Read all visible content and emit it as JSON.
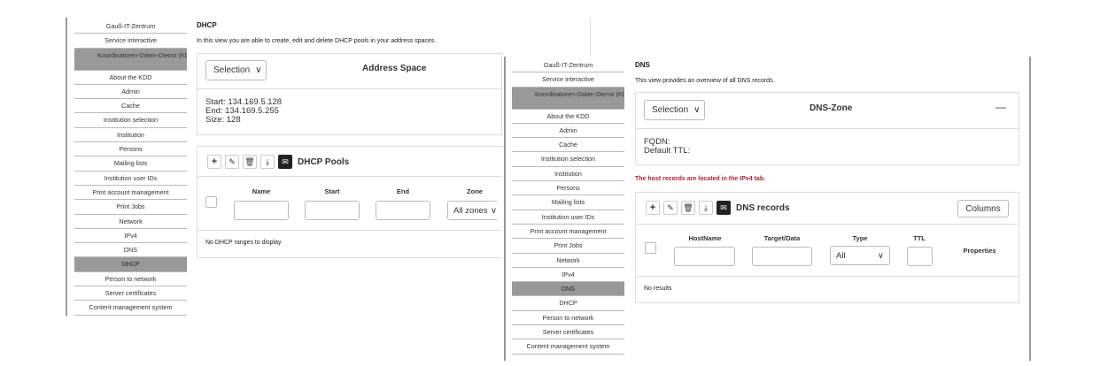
{
  "left": {
    "nav": [
      {
        "label": "Gauß-IT-Zentrum",
        "cls": "l0"
      },
      {
        "label": "Service interactive",
        "cls": "l0"
      },
      {
        "label": "Koordinatoren-Daten-Dienst (KDD)",
        "cls": "kdd"
      },
      {
        "label": "About the KDD",
        "cls": ""
      },
      {
        "label": "Admin",
        "cls": ""
      },
      {
        "label": "Cache",
        "cls": ""
      },
      {
        "label": "Institution selection",
        "cls": ""
      },
      {
        "label": "Institution",
        "cls": ""
      },
      {
        "label": "Persons",
        "cls": ""
      },
      {
        "label": "Mailing lists",
        "cls": ""
      },
      {
        "label": "Institution user IDs",
        "cls": ""
      },
      {
        "label": "Print account management",
        "cls": ""
      },
      {
        "label": "Print Jobs",
        "cls": ""
      },
      {
        "label": "Network",
        "cls": ""
      },
      {
        "label": "IPv4",
        "cls": ""
      },
      {
        "label": "DNS",
        "cls": ""
      },
      {
        "label": "DHCP",
        "cls": "sel"
      },
      {
        "label": "Person to network",
        "cls": ""
      },
      {
        "label": "Server certificates",
        "cls": ""
      },
      {
        "label": "Content management system",
        "cls": ""
      }
    ],
    "title": "DHCP",
    "desc": "In this view you are able to create, edit and delete DHCP pools in your address spaces.",
    "selection": "Selection",
    "section_title": "Address Space",
    "start": "Start: 134.169.5.128",
    "end": "End: 134.169.5.255",
    "size": "Size: 128",
    "table_title": "DHCP Pools",
    "cols": [
      "Name",
      "Start",
      "End",
      "Zone"
    ],
    "zone_value": "All zones",
    "empty": "No DHCP ranges to display"
  },
  "right": {
    "nav": [
      {
        "label": "Gauß-IT-Zentrum",
        "cls": "l0"
      },
      {
        "label": "Service interactive",
        "cls": "l0"
      },
      {
        "label": "Koordinatoren-Daten-Dienst (KDD)",
        "cls": "kdd"
      },
      {
        "label": "About the KDD",
        "cls": ""
      },
      {
        "label": "Admin",
        "cls": ""
      },
      {
        "label": "Cache",
        "cls": ""
      },
      {
        "label": "Institution selection",
        "cls": ""
      },
      {
        "label": "Institution",
        "cls": ""
      },
      {
        "label": "Persons",
        "cls": ""
      },
      {
        "label": "Mailing lists",
        "cls": ""
      },
      {
        "label": "Institution user IDs",
        "cls": ""
      },
      {
        "label": "Print account management",
        "cls": ""
      },
      {
        "label": "Print Jobs",
        "cls": ""
      },
      {
        "label": "Network",
        "cls": ""
      },
      {
        "label": "IPv4",
        "cls": ""
      },
      {
        "label": "DNS",
        "cls": "sel"
      },
      {
        "label": "DHCP",
        "cls": ""
      },
      {
        "label": "Person to network",
        "cls": ""
      },
      {
        "label": "Server certificates",
        "cls": ""
      },
      {
        "label": "Content management system",
        "cls": ""
      }
    ],
    "title": "DNS",
    "desc": "This view provides an overview of all DNS records.",
    "selection": "Selection",
    "section_title": "DNS-Zone",
    "collapse": "—",
    "fqdn": "FQDN:",
    "ttl": "Default TTL:",
    "warning": "The host records are located in the IPv4 tab.",
    "table_title": "DNS records",
    "columns_btn": "Columns",
    "cols": [
      "HostName",
      "Target/Data",
      "Type",
      "TTL",
      "Properties"
    ],
    "type_value": "All",
    "empty": "No results"
  }
}
